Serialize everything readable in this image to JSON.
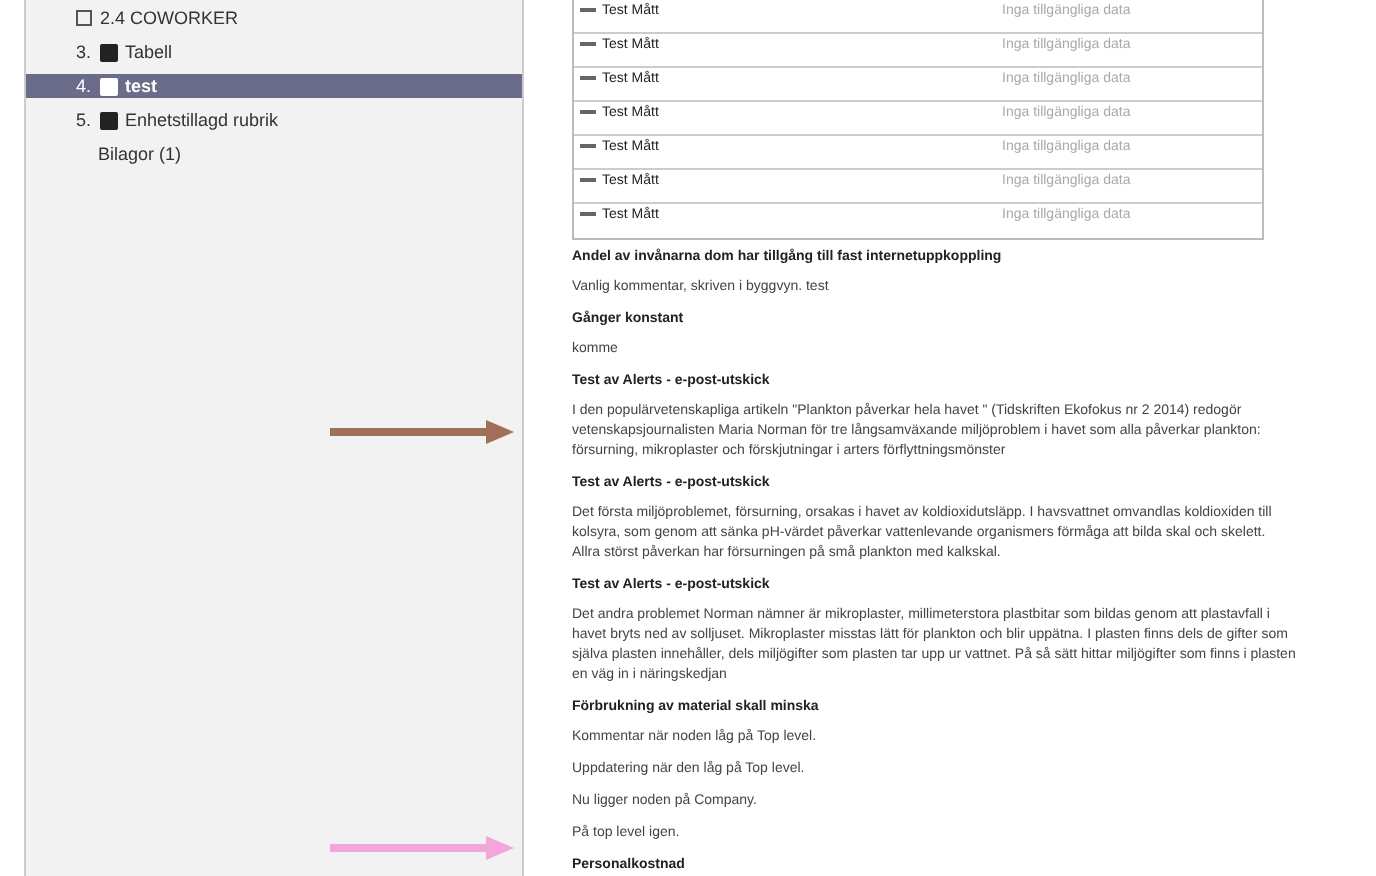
{
  "sidebar": {
    "items": [
      {
        "kind": "folder",
        "label": "2.4 COWORKER",
        "selected": false
      },
      {
        "kind": "page",
        "number": "3.",
        "label": "Tabell",
        "selected": false
      },
      {
        "kind": "page",
        "number": "4.",
        "label": "test",
        "selected": true
      },
      {
        "kind": "page",
        "number": "5.",
        "label": "Enhetstillagd rubrik",
        "selected": false
      },
      {
        "kind": "attachments",
        "label": "Bilagor (1)",
        "selected": false
      }
    ]
  },
  "table": {
    "rows": [
      {
        "name": "Test Mått",
        "value": "Inga tillgängliga data"
      },
      {
        "name": "Test Mått",
        "value": "Inga tillgängliga data"
      },
      {
        "name": "Test Mått",
        "value": "Inga tillgängliga data"
      },
      {
        "name": "Test Mått",
        "value": "Inga tillgängliga data"
      },
      {
        "name": "Test Mått",
        "value": "Inga tillgängliga data"
      },
      {
        "name": "Test Mått",
        "value": "Inga tillgängliga data"
      },
      {
        "name": "Test Mått",
        "value": "Inga tillgängliga data"
      }
    ]
  },
  "content": [
    {
      "kind": "heading",
      "text": "Andel av invånarna dom har tillgång till fast internetuppkoppling"
    },
    {
      "kind": "paragraph",
      "text": "Vanlig kommentar, skriven i byggvyn. test"
    },
    {
      "kind": "heading",
      "text": "Gånger konstant"
    },
    {
      "kind": "paragraph",
      "text": "komme"
    },
    {
      "kind": "heading",
      "text": "Test av Alerts - e-post-utskick"
    },
    {
      "kind": "paragraph",
      "text": "I den populärvetenskapliga artikeln \"Plankton påverkar hela havet \" (Tidskriften Ekofokus nr 2 2014) redogör vetenskapsjournalisten Maria Norman för tre långsamväxande miljöproblem i havet som alla påverkar plankton: försurning, mikroplaster och förskjutningar i arters förflyttningsmönster"
    },
    {
      "kind": "heading",
      "text": "Test av Alerts - e-post-utskick"
    },
    {
      "kind": "paragraph",
      "text": "Det första miljöproblemet, försurning, orsakas i havet av koldioxidutsläpp. I havsvattnet omvandlas koldioxiden till kolsyra, som genom att sänka pH-värdet påverkar vattenlevande organismers förmåga att bilda skal och skelett. Allra störst påverkan har försurningen på små plankton med kalkskal."
    },
    {
      "kind": "heading",
      "text": "Test av Alerts - e-post-utskick"
    },
    {
      "kind": "paragraph",
      "text": "Det andra problemet Norman nämner är mikroplaster, millimeterstora plastbitar som bildas genom att plastavfall i havet bryts ned av solljuset. Mikroplaster misstas lätt för plankton och blir uppätna. I plasten finns dels de gifter som själva plasten innehåller, dels miljögifter som plasten tar upp ur vattnet. På så sätt hittar miljögifter som finns i plasten en väg in i näringskedjan"
    },
    {
      "kind": "heading",
      "text": "Förbrukning av material skall minska"
    },
    {
      "kind": "paragraph",
      "text": "Kommentar när noden låg på Top level."
    },
    {
      "kind": "paragraph",
      "text": "Uppdatering när den låg på Top level."
    },
    {
      "kind": "paragraph",
      "text": "Nu ligger noden på Company."
    },
    {
      "kind": "paragraph",
      "text": "På top level igen."
    },
    {
      "kind": "heading",
      "text": "Personalkostnad"
    }
  ],
  "annotations": [
    {
      "color": "#a0705a"
    },
    {
      "color": "#f4a6d8"
    }
  ]
}
